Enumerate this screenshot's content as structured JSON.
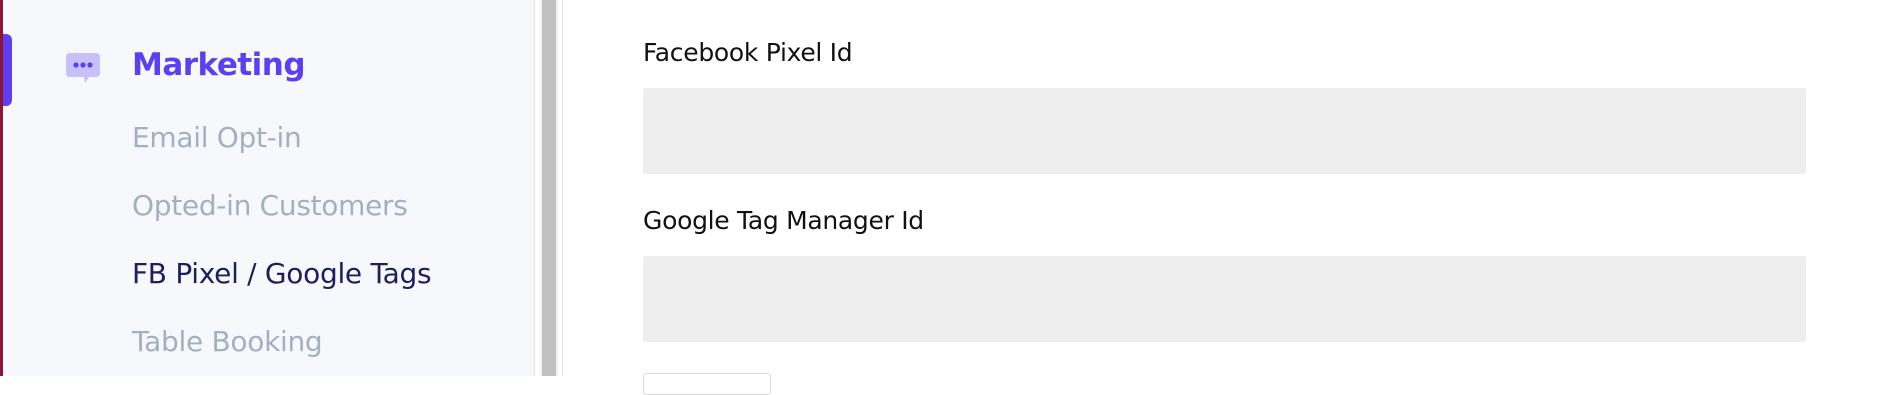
{
  "sidebar": {
    "section": {
      "title": "Marketing",
      "icon": "chat-bubble-icon",
      "accent_color": "#5b3ff0"
    },
    "items": [
      {
        "label": "Email Opt-in",
        "active": false
      },
      {
        "label": "Opted-in Customers",
        "active": false
      },
      {
        "label": "FB Pixel / Google Tags",
        "active": true
      },
      {
        "label": "Table Booking",
        "active": false
      }
    ]
  },
  "form": {
    "facebook_pixel": {
      "label": "Facebook Pixel Id",
      "value": "",
      "placeholder": ""
    },
    "google_tag_manager": {
      "label": "Google Tag Manager Id",
      "value": "",
      "placeholder": ""
    }
  },
  "colors": {
    "sidebar_bg": "#f7f8fc",
    "inactive_item": "#a5afc2",
    "active_item": "#1d1e5c",
    "input_bg": "#eeeeee"
  }
}
